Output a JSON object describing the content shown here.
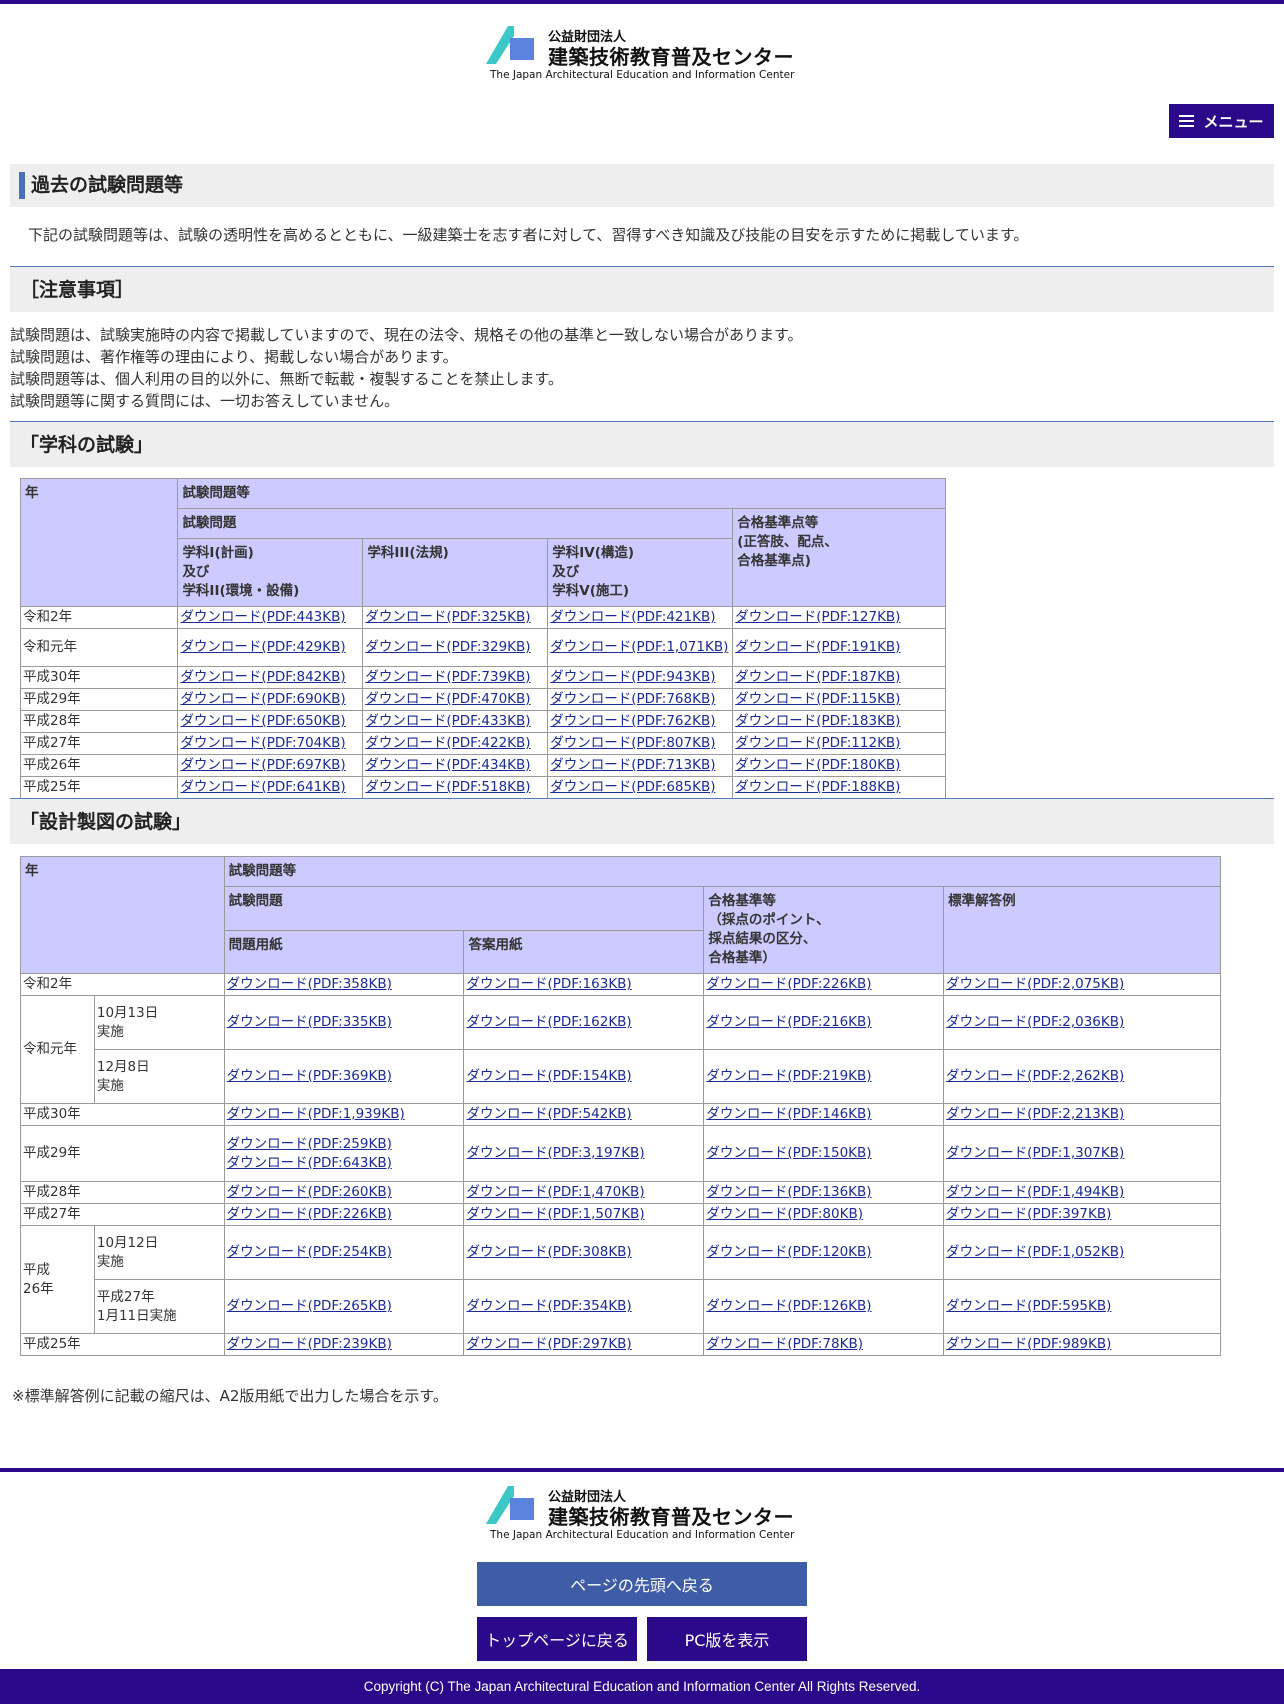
{
  "colors": {
    "accent": "#2a0a8a",
    "table_header": "#cccbff",
    "link": "#1a2a9a",
    "blue_button": "#3f5ca6",
    "logo_cyan": "#3cc8c8",
    "logo_blue": "#5b82dd"
  },
  "header": {
    "logo_small": "公益財団法人",
    "logo_big": "建築技術教育普及センター",
    "logo_en": "The Japan Architectural Education and Information Center",
    "menu_label": "メニュー",
    "menu_icon": "hamburger-icon"
  },
  "page_title": "過去の試験問題等",
  "intro": "下記の試験問題等は、試験の透明性を高めるとともに、一級建築士を志す者に対して、習得すべき知識及び技能の目安を示すために掲載しています。",
  "notes_heading": "［注意事項］",
  "notes": [
    "試験問題は、試験実施時の内容で掲載していますので、現在の法令、規格その他の基準と一致しない場合があります。",
    "試験問題は、著作権等の理由により、掲載しない場合があります。",
    "試験問題等は、個人利用の目的以外に、無断で転載・複製することを禁止します。",
    "試験問題等に関する質問には、一切お答えしていません。"
  ],
  "gakka": {
    "heading": "「学科の試験」",
    "headers": {
      "year": "年",
      "group": "試験問題等",
      "sub": "試験問題",
      "col1": "学科I(計画)\n及び\n学科II(環境・設備)",
      "col2": "学科III(法規)",
      "col3": "学科IV(構造)\n及び\n学科V(施工)",
      "col4": "合格基準点等\n(正答肢、配点、\n合格基準点)"
    },
    "rows": [
      {
        "year": "令和2年",
        "links": [
          "ダウンロード(PDF:443KB)",
          "ダウンロード(PDF:325KB)",
          "ダウンロード(PDF:421KB)",
          "ダウンロード(PDF:127KB)"
        ]
      },
      {
        "year": "令和元年",
        "links": [
          "ダウンロード(PDF:429KB)",
          "ダウンロード(PDF:329KB)",
          "ダウンロード(PDF:1,071KB)",
          "ダウンロード(PDF:191KB)"
        ]
      },
      {
        "year": "平成30年",
        "links": [
          "ダウンロード(PDF:842KB)",
          "ダウンロード(PDF:739KB)",
          "ダウンロード(PDF:943KB)",
          "ダウンロード(PDF:187KB)"
        ]
      },
      {
        "year": "平成29年",
        "links": [
          "ダウンロード(PDF:690KB)",
          "ダウンロード(PDF:470KB)",
          "ダウンロード(PDF:768KB)",
          "ダウンロード(PDF:115KB)"
        ]
      },
      {
        "year": "平成28年",
        "links": [
          "ダウンロード(PDF:650KB)",
          "ダウンロード(PDF:433KB)",
          "ダウンロード(PDF:762KB)",
          "ダウンロード(PDF:183KB)"
        ]
      },
      {
        "year": "平成27年",
        "links": [
          "ダウンロード(PDF:704KB)",
          "ダウンロード(PDF:422KB)",
          "ダウンロード(PDF:807KB)",
          "ダウンロード(PDF:112KB)"
        ]
      },
      {
        "year": "平成26年",
        "links": [
          "ダウンロード(PDF:697KB)",
          "ダウンロード(PDF:434KB)",
          "ダウンロード(PDF:713KB)",
          "ダウンロード(PDF:180KB)"
        ]
      },
      {
        "year": "平成25年",
        "links": [
          "ダウンロード(PDF:641KB)",
          "ダウンロード(PDF:518KB)",
          "ダウンロード(PDF:685KB)",
          "ダウンロード(PDF:188KB)"
        ]
      }
    ]
  },
  "sekkei": {
    "heading": "「設計製図の試験」",
    "headers": {
      "year": "年",
      "group": "試験問題等",
      "sub": "試験問題",
      "col1": "問題用紙",
      "col2": "答案用紙",
      "col3": "合格基準等\n（採点のポイント、\n採点結果の区分、\n合格基準）",
      "col4": "標準解答例"
    },
    "rows": [
      {
        "year": "令和2年",
        "cols": [
          [
            "ダウンロード(PDF:358KB)"
          ],
          [
            "ダウンロード(PDF:163KB)"
          ],
          [
            "ダウンロード(PDF:226KB)"
          ],
          [
            "ダウンロード(PDF:2,075KB)"
          ]
        ]
      },
      {
        "year": "令和元年",
        "sub": "10月13日\n実施",
        "cols": [
          [
            "ダウンロード(PDF:335KB)"
          ],
          [
            "ダウンロード(PDF:162KB)"
          ],
          [
            "ダウンロード(PDF:216KB)"
          ],
          [
            "ダウンロード(PDF:2,036KB)"
          ]
        ]
      },
      {
        "sub": "12月8日\n実施",
        "cols": [
          [
            "ダウンロード(PDF:369KB)"
          ],
          [
            "ダウンロード(PDF:154KB)"
          ],
          [
            "ダウンロード(PDF:219KB)"
          ],
          [
            "ダウンロード(PDF:2,262KB)"
          ]
        ]
      },
      {
        "year": "平成30年",
        "cols": [
          [
            "ダウンロード(PDF:1,939KB)"
          ],
          [
            "ダウンロード(PDF:542KB)"
          ],
          [
            "ダウンロード(PDF:146KB)"
          ],
          [
            "ダウンロード(PDF:2,213KB)"
          ]
        ]
      },
      {
        "year": "平成29年",
        "cols": [
          [
            "ダウンロード(PDF:259KB)",
            "ダウンロード(PDF:643KB)"
          ],
          [
            "ダウンロード(PDF:3,197KB)"
          ],
          [
            "ダウンロード(PDF:150KB)"
          ],
          [
            "ダウンロード(PDF:1,307KB)"
          ]
        ]
      },
      {
        "year": "平成28年",
        "cols": [
          [
            "ダウンロード(PDF:260KB)"
          ],
          [
            "ダウンロード(PDF:1,470KB)"
          ],
          [
            "ダウンロード(PDF:136KB)"
          ],
          [
            "ダウンロード(PDF:1,494KB)"
          ]
        ]
      },
      {
        "year": "平成27年",
        "cols": [
          [
            "ダウンロード(PDF:226KB)"
          ],
          [
            "ダウンロード(PDF:1,507KB)"
          ],
          [
            "ダウンロード(PDF:80KB)"
          ],
          [
            "ダウンロード(PDF:397KB)"
          ]
        ]
      },
      {
        "year": "平成\n26年",
        "sub": "10月12日\n実施",
        "cols": [
          [
            "ダウンロード(PDF:254KB)"
          ],
          [
            "ダウンロード(PDF:308KB)"
          ],
          [
            "ダウンロード(PDF:120KB)"
          ],
          [
            "ダウンロード(PDF:1,052KB)"
          ]
        ]
      },
      {
        "sub": "平成27年\n1月11日実施",
        "cols": [
          [
            "ダウンロード(PDF:265KB)"
          ],
          [
            "ダウンロード(PDF:354KB)"
          ],
          [
            "ダウンロード(PDF:126KB)"
          ],
          [
            "ダウンロード(PDF:595KB)"
          ]
        ]
      },
      {
        "year": "平成25年",
        "cols": [
          [
            "ダウンロード(PDF:239KB)"
          ],
          [
            "ダウンロード(PDF:297KB)"
          ],
          [
            "ダウンロード(PDF:78KB)"
          ],
          [
            "ダウンロード(PDF:989KB)"
          ]
        ]
      }
    ],
    "footnote": "※標準解答例に記載の縮尺は、A2版用紙で出力した場合を示す。"
  },
  "footer": {
    "back_to_top": "ページの先頭へ戻る",
    "top_page": "トップページに戻る",
    "pc_view": "PC版を表示",
    "copyright": "Copyright (C) The Japan Architectural Education and Information Center All Rights Reserved."
  }
}
